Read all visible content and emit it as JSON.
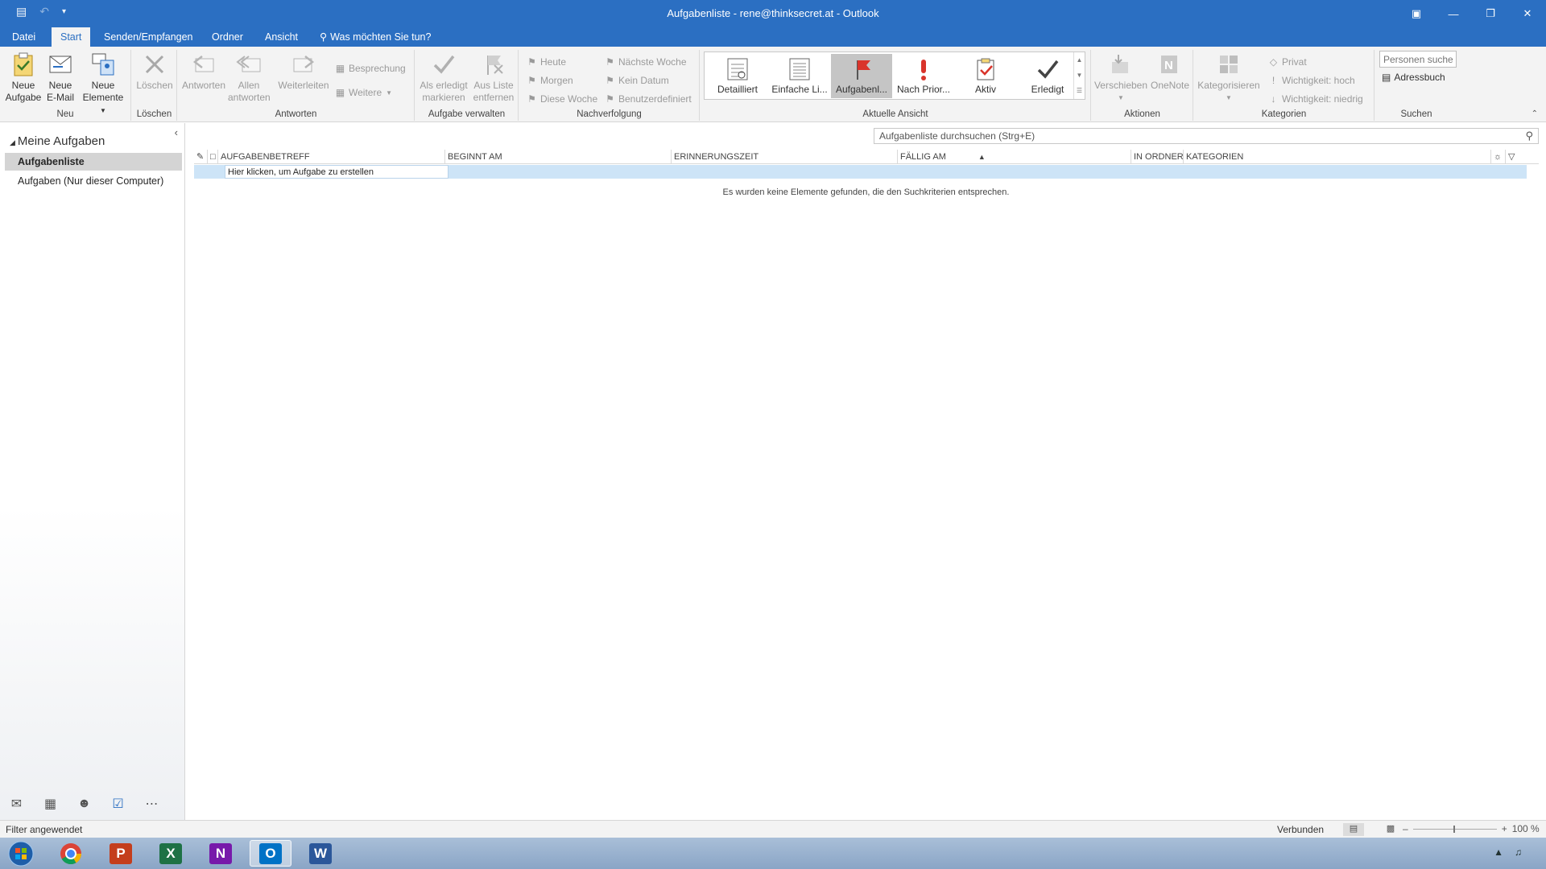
{
  "window": {
    "title": "Aufgabenliste - rene@thinksecret.at - Outlook"
  },
  "tabs": [
    {
      "label": "Datei"
    },
    {
      "label": "Start"
    },
    {
      "label": "Senden/Empfangen"
    },
    {
      "label": "Ordner"
    },
    {
      "label": "Ansicht"
    }
  ],
  "tell_me": "Was möchten Sie tun?",
  "ribbon": {
    "neu": {
      "label": "Neu",
      "new_task": [
        "Neue",
        "Aufgabe"
      ],
      "new_email": [
        "Neue",
        "E-Mail"
      ],
      "new_items": [
        "Neue",
        "Elemente"
      ]
    },
    "loeschen": {
      "label": "Löschen",
      "delete": "Löschen"
    },
    "antworten": {
      "label": "Antworten",
      "reply": "Antworten",
      "reply_all": [
        "Allen",
        "antworten"
      ],
      "forward": "Weiterleiten",
      "meeting": "Besprechung",
      "more": "Weitere"
    },
    "aufgabe_verwalten": {
      "label": "Aufgabe verwalten",
      "mark_complete": [
        "Als erledigt",
        "markieren"
      ],
      "remove_from_list": [
        "Aus Liste",
        "entfernen"
      ]
    },
    "nachverfolgung": {
      "label": "Nachverfolgung",
      "today": "Heute",
      "tomorrow": "Morgen",
      "this_week": "Diese Woche",
      "next_week": "Nächste Woche",
      "no_date": "Kein Datum",
      "custom": "Benutzerdefiniert"
    },
    "aktuelle_ansicht": {
      "label": "Aktuelle Ansicht",
      "views": [
        "Detailliert",
        "Einfache Li...",
        "Aufgabenl...",
        "Nach Prior...",
        "Aktiv",
        "Erledigt"
      ],
      "selected": "Aufgabenl..."
    },
    "aktionen": {
      "label": "Aktionen",
      "move": "Verschieben",
      "onenote": "OneNote"
    },
    "kategorien": {
      "label": "Kategorien",
      "categorize": "Kategorisieren",
      "private": "Privat",
      "high": "Wichtigkeit: hoch",
      "low": "Wichtigkeit: niedrig"
    },
    "suchen": {
      "label": "Suchen",
      "people_placeholder": "Personen suchen",
      "address_book": "Adressbuch"
    }
  },
  "nav": {
    "section": "Meine Aufgaben",
    "items": [
      {
        "label": "Aufgabenliste",
        "selected": true
      },
      {
        "label": "Aufgaben (Nur dieser Computer)",
        "selected": false
      }
    ]
  },
  "main": {
    "search_placeholder": "Aufgabenliste durchsuchen (Strg+E)",
    "columns": [
      "AUFGABENBETREFF",
      "BEGINNT AM",
      "ERINNERUNGSZEIT",
      "FÄLLIG AM",
      "IN ORDNER",
      "KATEGORIEN"
    ],
    "new_task_row": "Hier klicken, um Aufgabe zu erstellen",
    "empty_message": "Es wurden keine Elemente gefunden, die den Suchkriterien entsprechen."
  },
  "status": {
    "filter": "Filter angewendet",
    "connection": "Verbunden",
    "zoom": "100 %"
  },
  "colors": {
    "accent": "#2b6fc2",
    "ribbon_bg": "#f3f3f3",
    "selected_row": "#cde4f7"
  }
}
